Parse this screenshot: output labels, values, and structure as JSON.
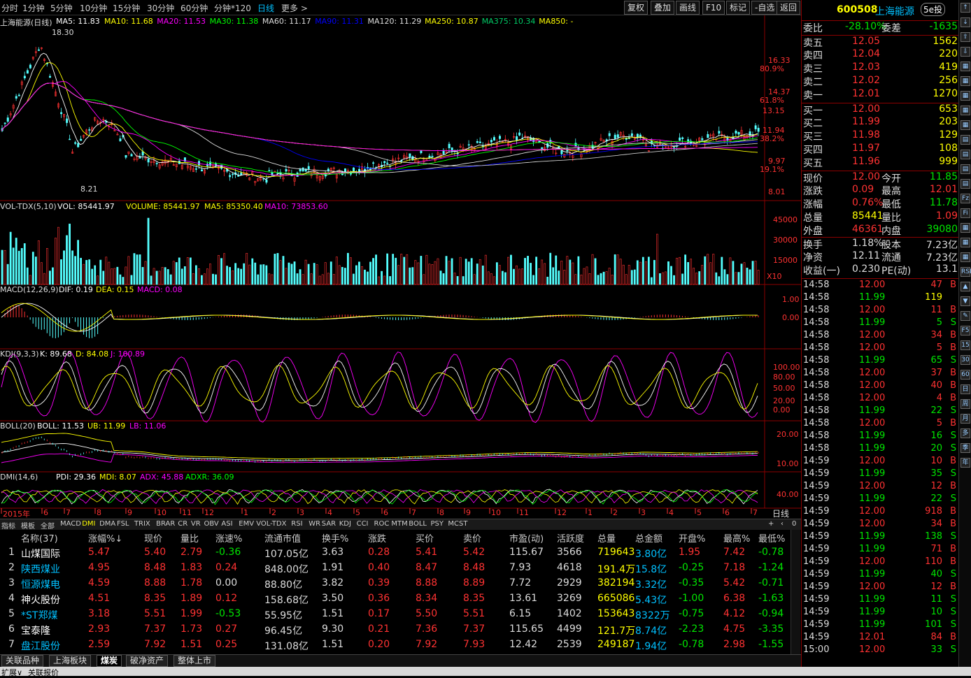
{
  "toolbar": {
    "periods": [
      "分时",
      "1分钟",
      "5分钟",
      "10分钟",
      "15分钟",
      "30分钟",
      "60分钟",
      "分钟*120",
      "日线",
      "更多 >"
    ],
    "buttons": [
      "复权",
      "叠加",
      "画线",
      "F10",
      "标记",
      "-自选",
      "返回"
    ]
  },
  "main": {
    "stock_label": "上海能源(日线)",
    "ma": [
      {
        "t": "MA5: 11.83",
        "c": "#ffffff"
      },
      {
        "t": "MA10: 11.68",
        "c": "#ffff00"
      },
      {
        "t": "MA20: 11.53",
        "c": "#ff00ff"
      },
      {
        "t": "MA30: 11.38",
        "c": "#00ff00"
      },
      {
        "t": "MA60: 11.17",
        "c": "#dddddd"
      },
      {
        "t": "MA90: 11.31",
        "c": "#0000ff"
      },
      {
        "t": "MA120: 11.29",
        "c": "#dddddd"
      },
      {
        "t": "MA250: 10.87",
        "c": "#ffff00"
      },
      {
        "t": "MA375: 10.34",
        "c": "#00cc66"
      },
      {
        "t": "MA850: -",
        "c": "#ffff00"
      }
    ],
    "high_mark": "18.30",
    "low_mark": "8.21",
    "price_axis": [
      "16.33",
      "80.9%",
      "14.37",
      "61.8%",
      "13.15",
      "11.94",
      "38.2%",
      "9.97",
      "19.1%",
      "8.01"
    ]
  },
  "volume": {
    "label": "VOL-TDX(5,10)",
    "vol": "VOL: 85441.97",
    "volume": "VOLUME: 85441.97",
    "ma5": "MA5: 85350.40",
    "ma10": "MA10: 73853.60",
    "axis": [
      "45000",
      "30000",
      "15000"
    ],
    "unit": "X10"
  },
  "macd": {
    "label": "MACD(12,26,9)",
    "dif": "DIF: 0.19",
    "dea": "DEA: 0.15",
    "macd": "MACD: 0.08",
    "axis": [
      "1.00",
      "0.00"
    ]
  },
  "kdj": {
    "label": "KDJ(9,3,3)",
    "k": "K: 89.68",
    "d": "D: 84.08",
    "j": "J: 100.89",
    "axis": [
      "100.00",
      "80.00",
      "50.00",
      "20.00",
      "0.00"
    ]
  },
  "boll": {
    "label": "BOLL(20)",
    "boll": "BOLL: 11.53",
    "ub": "UB: 11.99",
    "lb": "LB: 11.06",
    "axis": [
      "20.00",
      "10.00"
    ]
  },
  "dmi": {
    "label": "DMI(14,6)",
    "pdi": "PDI: 29.36",
    "mdi": "MDI: 8.07",
    "adx": "ADX: 45.88",
    "adxr": "ADXR: 36.09",
    "axis": [
      "40.00"
    ],
    "period": "日线"
  },
  "date_axis": [
    "2015年",
    "6",
    "7",
    "8",
    "9",
    "10",
    "11",
    "12",
    "1",
    "2",
    "3",
    "4",
    "5",
    "6",
    "7",
    "8",
    "9",
    "10",
    "11",
    "12",
    "1",
    "2",
    "3",
    "4",
    "5",
    "6",
    "7"
  ],
  "indicator_tabs": [
    "指标",
    "模板",
    "全部",
    "MACD",
    "DMI",
    "DMA",
    "FSL",
    "TRIX",
    "BRAR",
    "CR",
    "VR",
    "OBV",
    "ASI",
    "EMV",
    "VOL-TDX",
    "RSI",
    "WR",
    "SAR",
    "KDJ",
    "CCI",
    "ROC",
    "MTM",
    "BOLL",
    "PSY",
    "MCST"
  ],
  "table": {
    "headers": [
      "名称(37)",
      "涨幅%↓",
      "现价",
      "量比",
      "涨速%",
      "流通市值",
      "换手%",
      "涨跌",
      "买价",
      "卖价",
      "市盈(动)",
      "活跃度",
      "总量",
      "总金额",
      "开盘%",
      "最高%",
      "最低%"
    ],
    "rows": [
      {
        "n": "1",
        "name": "山煤国际",
        "nc": "#ffffff",
        "pct": "5.47",
        "price": "5.40",
        "lb": "2.79",
        "speed": "-0.36",
        "sc": "#00e600",
        "mv": "107.05亿",
        "turn": "3.63",
        "chg": "0.28",
        "buy": "5.41",
        "sell": "5.42",
        "pe": "115.67",
        "act": "3566",
        "vol": "719643",
        "amt": "3.80亿",
        "open": "1.95",
        "high": "7.42",
        "low": "-0.78"
      },
      {
        "n": "2",
        "name": "陕西煤业",
        "nc": "#00c0ff",
        "pct": "4.95",
        "price": "8.48",
        "lb": "1.83",
        "speed": "0.24",
        "sc": "#ff3232",
        "mv": "848.00亿",
        "turn": "1.91",
        "chg": "0.40",
        "buy": "8.47",
        "sell": "8.48",
        "pe": "7.93",
        "act": "4618",
        "vol": "191.4万",
        "amt": "15.8亿",
        "open": "-0.25",
        "high": "7.18",
        "low": "-1.24"
      },
      {
        "n": "3",
        "name": "恒源煤电",
        "nc": "#00c0ff",
        "pct": "4.59",
        "price": "8.88",
        "lb": "1.78",
        "speed": "0.00",
        "sc": "#dddddd",
        "mv": "88.80亿",
        "turn": "3.82",
        "chg": "0.39",
        "buy": "8.88",
        "sell": "8.89",
        "pe": "7.72",
        "act": "2929",
        "vol": "382194",
        "amt": "3.32亿",
        "open": "-0.35",
        "high": "5.42",
        "low": "-0.71"
      },
      {
        "n": "4",
        "name": "神火股份",
        "nc": "#ffffff",
        "pct": "4.51",
        "price": "8.35",
        "lb": "1.89",
        "speed": "0.12",
        "sc": "#ff3232",
        "mv": "158.68亿",
        "turn": "3.50",
        "chg": "0.36",
        "buy": "8.34",
        "sell": "8.35",
        "pe": "13.61",
        "act": "3269",
        "vol": "665086",
        "amt": "5.43亿",
        "open": "-1.00",
        "high": "6.38",
        "low": "-1.63"
      },
      {
        "n": "5",
        "name": "*ST郑煤",
        "nc": "#00c0ff",
        "pct": "3.18",
        "price": "5.51",
        "lb": "1.99",
        "speed": "-0.53",
        "sc": "#00e600",
        "mv": "55.95亿",
        "turn": "1.51",
        "chg": "0.17",
        "buy": "5.50",
        "sell": "5.51",
        "pe": "6.15",
        "act": "1402",
        "vol": "153643",
        "amt": "8322万",
        "open": "-0.75",
        "high": "4.12",
        "low": "-0.94"
      },
      {
        "n": "6",
        "name": "宝泰隆",
        "nc": "#ffffff",
        "pct": "2.93",
        "price": "7.37",
        "lb": "1.73",
        "speed": "0.27",
        "sc": "#ff3232",
        "mv": "96.45亿",
        "turn": "9.30",
        "chg": "0.21",
        "buy": "7.36",
        "sell": "7.37",
        "pe": "115.65",
        "act": "4499",
        "vol": "121.7万",
        "amt": "8.74亿",
        "open": "-2.23",
        "high": "4.75",
        "low": "-3.35"
      },
      {
        "n": "7",
        "name": "盘江股份",
        "nc": "#00c0ff",
        "pct": "2.59",
        "price": "7.92",
        "lb": "1.51",
        "speed": "0.25",
        "sc": "#ff3232",
        "mv": "131.08亿",
        "turn": "1.51",
        "chg": "0.20",
        "buy": "7.92",
        "sell": "7.93",
        "pe": "12.42",
        "act": "2539",
        "vol": "249187",
        "amt": "1.94亿",
        "open": "-0.78",
        "high": "2.98",
        "low": "-1.55"
      }
    ]
  },
  "bottom_tabs": [
    "关联品种",
    "上海板块",
    "煤炭",
    "破净资产",
    "整体上市"
  ],
  "status": [
    "扩展∨",
    "关联报价"
  ],
  "quote": {
    "code": "600508",
    "name": "上海能源",
    "logo": "5e投",
    "weibi_label": "委比",
    "weibi": "-28.10%",
    "weicha_label": "委差",
    "weicha": "-1635",
    "asks": [
      {
        "l": "卖五",
        "p": "12.05",
        "v": "1562"
      },
      {
        "l": "卖四",
        "p": "12.04",
        "v": "220"
      },
      {
        "l": "卖三",
        "p": "12.03",
        "v": "419"
      },
      {
        "l": "卖二",
        "p": "12.02",
        "v": "256"
      },
      {
        "l": "卖一",
        "p": "12.01",
        "v": "1270"
      }
    ],
    "bids": [
      {
        "l": "买一",
        "p": "12.00",
        "v": "653"
      },
      {
        "l": "买二",
        "p": "11.99",
        "v": "203"
      },
      {
        "l": "买三",
        "p": "11.98",
        "v": "129"
      },
      {
        "l": "买四",
        "p": "11.97",
        "v": "108"
      },
      {
        "l": "买五",
        "p": "11.96",
        "v": "999"
      }
    ],
    "stats": [
      {
        "l1": "现价",
        "v1": "12.00",
        "c1": "#ff3232",
        "l2": "今开",
        "v2": "11.85",
        "c2": "#00e600"
      },
      {
        "l1": "涨跌",
        "v1": "0.09",
        "c1": "#ff3232",
        "l2": "最高",
        "v2": "12.01",
        "c2": "#ff3232"
      },
      {
        "l1": "涨幅",
        "v1": "0.76%",
        "c1": "#ff3232",
        "l2": "最低",
        "v2": "11.78",
        "c2": "#00e600"
      },
      {
        "l1": "总量",
        "v1": "85441",
        "c1": "#ffff00",
        "l2": "量比",
        "v2": "1.09",
        "c2": "#ff3232"
      },
      {
        "l1": "外盘",
        "v1": "46361",
        "c1": "#ff3232",
        "l2": "内盘",
        "v2": "39080",
        "c2": "#00e600"
      },
      {
        "l1": "换手",
        "v1": "1.18%",
        "c1": "#dddddd",
        "l2": "股本",
        "v2": "7.23亿",
        "c2": "#dddddd"
      },
      {
        "l1": "净资",
        "v1": "12.11",
        "c1": "#dddddd",
        "l2": "流通",
        "v2": "7.23亿",
        "c2": "#dddddd"
      },
      {
        "l1": "收益(一)",
        "v1": "0.230",
        "c1": "#dddddd",
        "l2": "PE(动)",
        "v2": "13.1",
        "c2": "#dddddd"
      }
    ],
    "ticks": [
      [
        "14:58",
        "12.00",
        "47",
        "B"
      ],
      [
        "14:58",
        "11.99",
        "119",
        ""
      ],
      [
        "14:58",
        "12.00",
        "11",
        "B"
      ],
      [
        "14:58",
        "11.99",
        "5",
        "S"
      ],
      [
        "14:58",
        "12.00",
        "34",
        "B"
      ],
      [
        "14:58",
        "12.00",
        "5",
        "B"
      ],
      [
        "14:58",
        "11.99",
        "65",
        "S"
      ],
      [
        "14:58",
        "12.00",
        "37",
        "B"
      ],
      [
        "14:58",
        "12.00",
        "40",
        "B"
      ],
      [
        "14:58",
        "12.00",
        "4",
        "B"
      ],
      [
        "14:58",
        "11.99",
        "22",
        "S"
      ],
      [
        "14:58",
        "12.00",
        "5",
        "B"
      ],
      [
        "14:58",
        "11.99",
        "16",
        "S"
      ],
      [
        "14:58",
        "11.99",
        "20",
        "S"
      ],
      [
        "14:59",
        "12.00",
        "10",
        "B"
      ],
      [
        "14:59",
        "11.99",
        "35",
        "S"
      ],
      [
        "14:59",
        "12.00",
        "12",
        "B"
      ],
      [
        "14:59",
        "11.99",
        "22",
        "S"
      ],
      [
        "14:59",
        "12.00",
        "918",
        "B"
      ],
      [
        "14:59",
        "12.00",
        "34",
        "B"
      ],
      [
        "14:59",
        "11.99",
        "138",
        "S"
      ],
      [
        "14:59",
        "11.99",
        "71",
        "B"
      ],
      [
        "14:59",
        "12.00",
        "110",
        "B"
      ],
      [
        "14:59",
        "11.99",
        "40",
        "S"
      ],
      [
        "14:59",
        "12.00",
        "12",
        "B"
      ],
      [
        "14:59",
        "11.99",
        "11",
        "S"
      ],
      [
        "14:59",
        "11.99",
        "10",
        "S"
      ],
      [
        "14:59",
        "11.99",
        "101",
        "S"
      ],
      [
        "14:59",
        "12.01",
        "84",
        "B"
      ],
      [
        "15:00",
        "12.00",
        "33",
        "S"
      ]
    ],
    "bottom_tabs": [
      "笔",
      "价",
      "细"
    ]
  },
  "sidebar_icons": [
    "↑",
    "↓",
    "⇧",
    "⇩",
    "▦",
    "▦",
    "▦",
    "▦",
    "▦",
    "▤",
    "▤",
    "▤",
    "▤",
    "Fz",
    "Fi",
    "▦",
    "▦",
    "▦",
    "RSI",
    "▲",
    "▼",
    "✎",
    "F5",
    "15",
    "30",
    "60",
    "日",
    "周",
    "月",
    "多",
    "季",
    "年"
  ]
}
